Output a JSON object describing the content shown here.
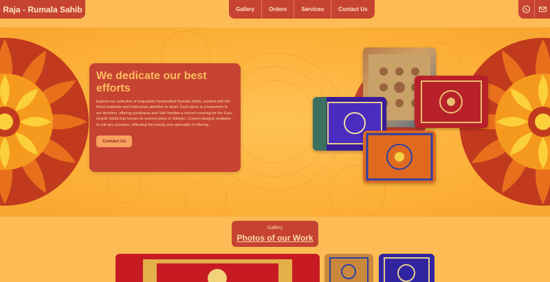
{
  "header": {
    "brand": "Raja - Rumala Sahib",
    "nav": [
      "Gallery",
      "Orders",
      "Services",
      "Contact Us"
    ],
    "social_icons": [
      "whatsapp-icon",
      "mail-icon"
    ]
  },
  "hero": {
    "title": "We dedicate our best efforts",
    "body": "Explore our collection of exquisitely handcrafted Rumala Sahib, created with the finest materials and meticulous attention to detail. Each piece is a testament to our devotion, offering gurdwaras and Sikh families a sacred covering for the Guru Granth Sahib that honors its revered place in Sikhism. Custom designs available to suit any occasion, reflecting the beauty and spirituality of offering.",
    "button": "Contact Us"
  },
  "gallery": {
    "label": "Gallery",
    "heading": "Photos of our Work"
  },
  "colors": {
    "background": "#fdbb55",
    "accent": "#c64332",
    "light_text": "#fde6c2"
  }
}
